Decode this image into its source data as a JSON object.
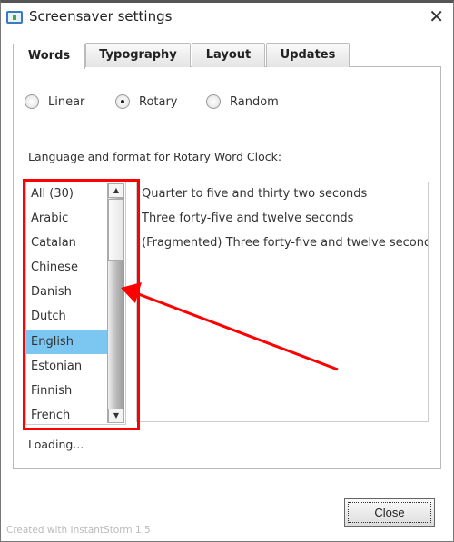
{
  "window": {
    "title": "Screensaver settings",
    "close_glyph": "✕"
  },
  "tabs": [
    {
      "label": "Words",
      "active": true
    },
    {
      "label": "Typography"
    },
    {
      "label": "Layout"
    },
    {
      "label": "Updates"
    }
  ],
  "modes": [
    {
      "label": "Linear",
      "selected": false
    },
    {
      "label": "Rotary",
      "selected": true
    },
    {
      "label": "Random",
      "selected": false
    }
  ],
  "language_label": "Language and format for Rotary Word Clock:",
  "languages": [
    "All (30)",
    "Arabic",
    "Catalan",
    "Chinese",
    "Danish",
    "Dutch",
    "English",
    "Estonian",
    "Finnish",
    "French"
  ],
  "selected_language": "English",
  "preview_lines": [
    "Quarter to five and thirty two seconds",
    "Three forty-five and twelve seconds",
    "(Fragmented) Three forty-five and twelve seconds"
  ],
  "status": "Loading...",
  "close_button": "Close",
  "footer": "Created with InstantStorm 1.5",
  "annotation_color": "#ff0000",
  "selection_color": "#7cc6f2"
}
